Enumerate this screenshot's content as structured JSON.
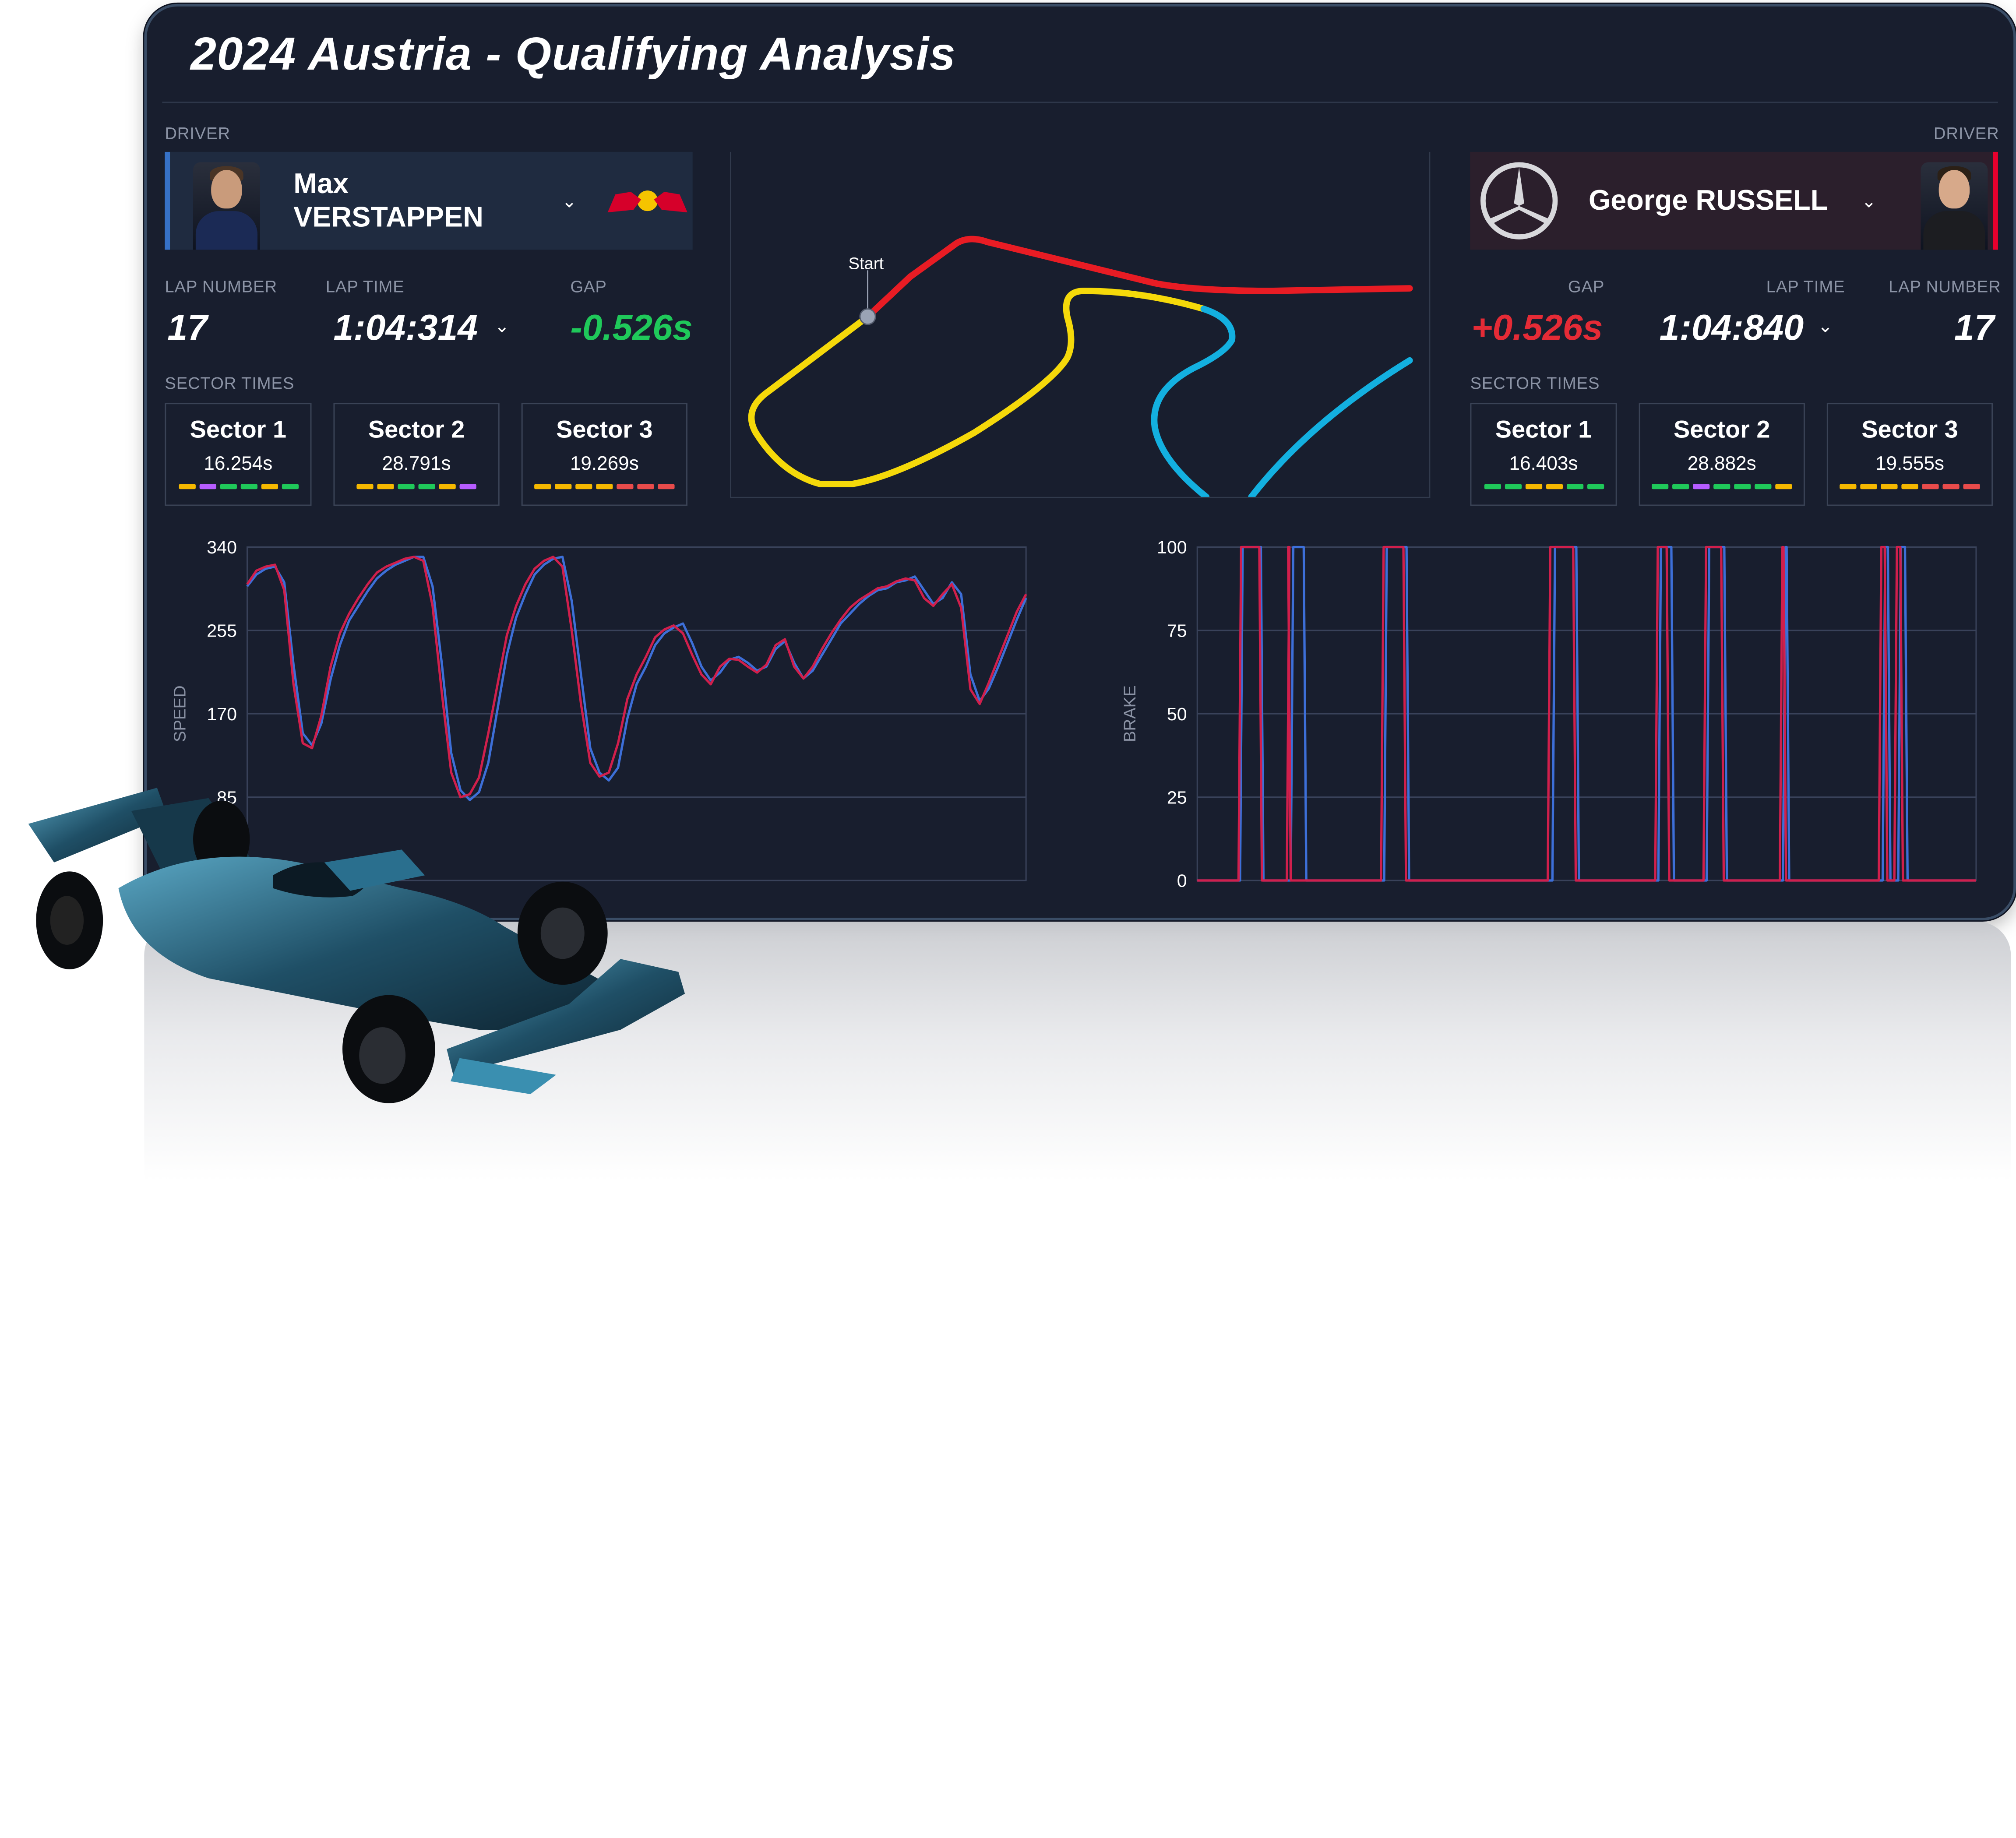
{
  "title": "2024 Austria - Qualifying Analysis",
  "left_driver": {
    "label": "DRIVER",
    "name": "Max VERSTAPPEN",
    "team_logo": "red-bull-logo",
    "lap_number_label": "LAP NUMBER",
    "lap_number": "17",
    "lap_time_label": "LAP TIME",
    "lap_time": "1:04:314",
    "gap_label": "GAP",
    "gap": "-0.526s",
    "sector_times_label": "SECTOR TIMES",
    "accent": "#3671c6",
    "sectors": [
      {
        "label": "Sector 1",
        "time": "16.254s",
        "minisectors": [
          "#f5b800",
          "#b65cff",
          "#1fc95a",
          "#1fc95a",
          "#f5b800",
          "#1fc95a"
        ]
      },
      {
        "label": "Sector 2",
        "time": "28.791s",
        "minisectors": [
          "#f5b800",
          "#f5b800",
          "#1fc95a",
          "#1fc95a",
          "#f5b800",
          "#b65cff"
        ]
      },
      {
        "label": "Sector 3",
        "time": "19.269s",
        "minisectors": [
          "#f5b800",
          "#f5b800",
          "#f5b800",
          "#f5b800",
          "#e84b4b",
          "#e84b4b",
          "#e84b4b"
        ]
      }
    ]
  },
  "right_driver": {
    "label": "DRIVER",
    "name": "George RUSSELL",
    "team_logo": "mercedes-logo",
    "lap_number_label": "LAP NUMBER",
    "lap_number": "17",
    "lap_time_label": "LAP TIME",
    "lap_time": "1:04:840",
    "gap_label": "GAP",
    "gap": "+0.526s",
    "sector_times_label": "SECTOR TIMES",
    "accent": "#e8002d",
    "sectors": [
      {
        "label": "Sector 1",
        "time": "16.403s",
        "minisectors": [
          "#1fc95a",
          "#1fc95a",
          "#f5b800",
          "#f5b800",
          "#1fc95a",
          "#1fc95a"
        ]
      },
      {
        "label": "Sector 2",
        "time": "28.882s",
        "minisectors": [
          "#1fc95a",
          "#1fc95a",
          "#b65cff",
          "#1fc95a",
          "#1fc95a",
          "#1fc95a",
          "#f5b800"
        ]
      },
      {
        "label": "Sector 3",
        "time": "19.555s",
        "minisectors": [
          "#f5b800",
          "#f5b800",
          "#f5b800",
          "#f5b800",
          "#e84b4b",
          "#e84b4b",
          "#e84b4b"
        ]
      }
    ]
  },
  "track_map": {
    "start_label": "Start",
    "sector_colors": [
      "#e81c24",
      "#f5d90a",
      "#13b0e0"
    ]
  },
  "colors": {
    "panel_bg": "#181e2e",
    "verstappen_line": "#3d6fd8",
    "russell_line": "#d11f4c",
    "grid": "#39425a"
  },
  "chart_data": [
    {
      "type": "line",
      "title": "",
      "ylabel": "SPEED",
      "xlabel": "",
      "ylim": [
        0,
        340
      ],
      "yticks": [
        85,
        170,
        255,
        340
      ],
      "grid": true,
      "series": [
        {
          "color": "#3d6fd8",
          "values": [
            300,
            312,
            318,
            320,
            304,
            220,
            150,
            138,
            160,
            205,
            240,
            265,
            280,
            295,
            308,
            316,
            322,
            326,
            330,
            330,
            300,
            220,
            130,
            92,
            82,
            90,
            120,
            175,
            230,
            268,
            292,
            312,
            322,
            328,
            330,
            285,
            210,
            135,
            110,
            102,
            115,
            165,
            200,
            218,
            240,
            252,
            258,
            262,
            242,
            218,
            204,
            212,
            225,
            228,
            222,
            214,
            218,
            236,
            244,
            222,
            206,
            214,
            230,
            246,
            262,
            272,
            282,
            290,
            296,
            298,
            304,
            306,
            310,
            296,
            282,
            288,
            304,
            292,
            210,
            183,
            196,
            218,
            242,
            266,
            288
          ]
        },
        {
          "color": "#d11f4c",
          "values": [
            302,
            316,
            320,
            322,
            296,
            200,
            140,
            135,
            168,
            218,
            252,
            272,
            288,
            302,
            314,
            320,
            324,
            328,
            330,
            326,
            280,
            190,
            110,
            85,
            88,
            105,
            150,
            200,
            250,
            280,
            302,
            318,
            326,
            330,
            320,
            255,
            180,
            120,
            106,
            110,
            140,
            185,
            210,
            228,
            248,
            256,
            260,
            252,
            230,
            210,
            200,
            218,
            226,
            225,
            218,
            212,
            220,
            240,
            246,
            218,
            206,
            218,
            236,
            252,
            266,
            278,
            286,
            292,
            298,
            300,
            305,
            308,
            306,
            288,
            280,
            292,
            302,
            278,
            195,
            180,
            202,
            226,
            250,
            274,
            292
          ]
        }
      ]
    },
    {
      "type": "line",
      "title": "",
      "ylabel": "BRAKE",
      "xlabel": "",
      "ylim": [
        0,
        100
      ],
      "yticks": [
        0,
        25,
        50,
        75,
        100
      ],
      "grid": true,
      "series": [
        {
          "color": "#3d6fd8",
          "pulses": [
            [
              0.055,
              0.085
            ],
            [
              0.12,
              0.14
            ],
            [
              0.24,
              0.272
            ],
            [
              0.456,
              0.49
            ],
            [
              0.592,
              0.612
            ],
            [
              0.654,
              0.68
            ],
            [
              0.752,
              0.76
            ],
            [
              0.88,
              0.89
            ],
            [
              0.9,
              0.912
            ]
          ]
        },
        {
          "color": "#d11f4c",
          "pulses": [
            [
              0.053,
              0.083
            ],
            [
              0.115,
              0.12
            ],
            [
              0.236,
              0.268
            ],
            [
              0.45,
              0.486
            ],
            [
              0.588,
              0.606
            ],
            [
              0.65,
              0.676
            ],
            [
              0.748,
              0.756
            ],
            [
              0.875,
              0.886
            ],
            [
              0.895,
              0.906
            ]
          ]
        }
      ]
    }
  ]
}
